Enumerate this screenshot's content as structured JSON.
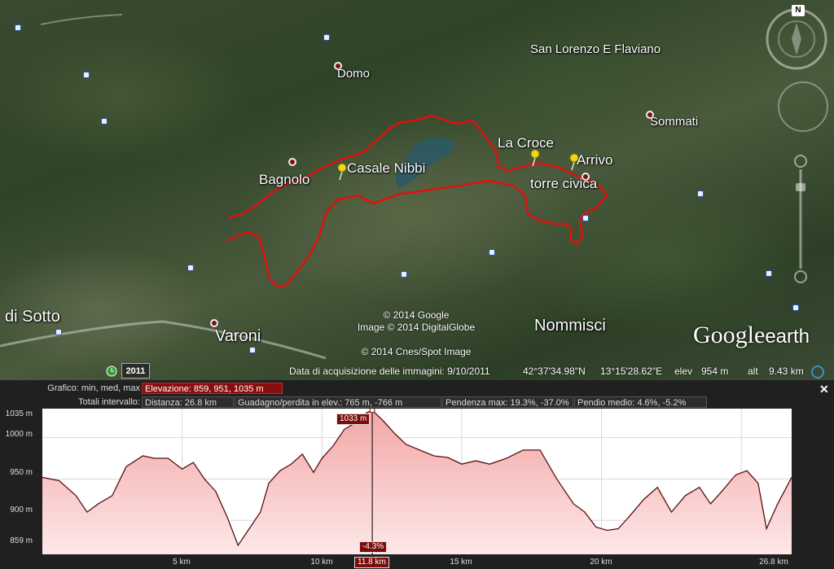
{
  "map": {
    "places": {
      "san_lorenzo": "San Lorenzo E Flaviano",
      "domo": "Domo",
      "sommati": "Sommati",
      "bagnolo": "Bagnolo",
      "casale_nibbi": "Casale Nibbi",
      "la_croce": "La Croce",
      "arrivo": "Arrivo",
      "torre_civica": "torre civica",
      "di_sotto": "di Sotto",
      "varoni": "Varoni",
      "nommisci": "Nommisci"
    },
    "copyright": {
      "google": "© 2014 Google",
      "image": "Image © 2014 DigitalGlobe",
      "cnes": "© 2014 Cnes/Spot Image"
    },
    "logo_google": "Google",
    "logo_earth": "earth",
    "north_label": "N"
  },
  "status": {
    "year": "2011",
    "acquisition": "Data di acquisizione delle immagini: 9/10/2011",
    "lat": "42°37'34.98\"N",
    "lon": "13°15'28.62\"E",
    "elev_label": "elev",
    "elev_value": "954 m",
    "alt_label": "alt",
    "alt_value": "9.43 km"
  },
  "profile": {
    "grafico_label": "Grafico: min, med, max",
    "elevazione": "Elevazione: 859, 951, 1035 m",
    "totali_label": "Totali intervallo:",
    "distanza": "Distanza: 26.8 km",
    "guadagno": "Guadagno/perdita in elev.: 765 m, -766 m",
    "pendenza_max": "Pendenza max: 19.3%, -37.0%",
    "pendio_medio": "Pendio medio: 4.6%, -5.2%",
    "close_label": "✕",
    "cursor_elev": "1033 m",
    "cursor_slope": "-4.3%",
    "cursor_dist": "11.8 km",
    "y_ticks": [
      "1035 m",
      "1000 m",
      "950 m",
      "900 m",
      "859 m"
    ],
    "x_ticks": [
      "5 km",
      "10 km",
      "15 km",
      "20 km",
      "26.8 km"
    ]
  },
  "chart_data": {
    "type": "area",
    "title": "",
    "xlabel": "",
    "ylabel": "",
    "xlim": [
      0,
      26.8
    ],
    "ylim": [
      859,
      1035
    ],
    "x": [
      0,
      0.6,
      1.2,
      1.6,
      2.0,
      2.5,
      3.0,
      3.6,
      4.0,
      4.5,
      5.0,
      5.4,
      5.8,
      6.2,
      6.6,
      7.0,
      7.4,
      7.8,
      8.1,
      8.5,
      8.9,
      9.3,
      9.7,
      10.0,
      10.4,
      10.8,
      11.2,
      11.6,
      11.8,
      12.2,
      12.6,
      13.0,
      13.5,
      14.0,
      14.5,
      15.0,
      15.5,
      16.0,
      16.6,
      17.2,
      17.8,
      18.4,
      19.0,
      19.4,
      19.8,
      20.2,
      20.6,
      21.0,
      21.5,
      22.0,
      22.5,
      23.0,
      23.5,
      23.9,
      24.3,
      24.8,
      25.2,
      25.6,
      25.9,
      26.3,
      26.8
    ],
    "y": [
      952,
      948,
      930,
      910,
      920,
      930,
      965,
      978,
      975,
      975,
      962,
      970,
      950,
      935,
      905,
      870,
      890,
      910,
      945,
      960,
      968,
      980,
      958,
      975,
      990,
      1010,
      1018,
      1030,
      1033,
      1020,
      1005,
      992,
      985,
      978,
      976,
      968,
      972,
      968,
      975,
      985,
      985,
      950,
      920,
      910,
      892,
      888,
      890,
      905,
      925,
      940,
      910,
      930,
      940,
      920,
      935,
      955,
      960,
      945,
      890,
      920,
      952
    ]
  }
}
